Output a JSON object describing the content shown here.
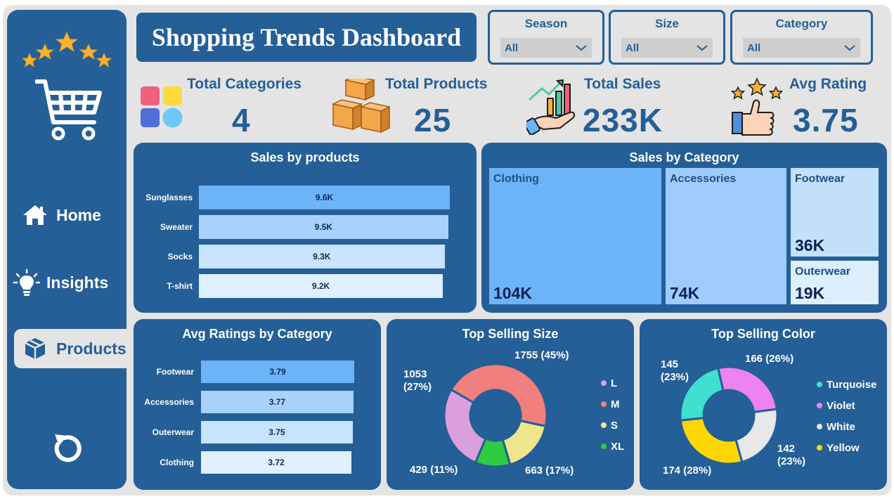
{
  "title": "Shopping Trends Dashboard",
  "nav": [
    {
      "label": "Home",
      "icon": "home-icon"
    },
    {
      "label": "Insights",
      "icon": "lightbulb-icon"
    },
    {
      "label": "Products",
      "icon": "box-icon",
      "active": true
    }
  ],
  "slicers": [
    {
      "label": "Season",
      "value": "All"
    },
    {
      "label": "Size",
      "value": "All"
    },
    {
      "label": "Category",
      "value": "All"
    }
  ],
  "kpis": [
    {
      "title": "Total Categories",
      "value": "4",
      "icon": "categories-icon"
    },
    {
      "title": "Total Products",
      "value": "25",
      "icon": "boxes-icon"
    },
    {
      "title": "Total Sales",
      "value": "233K",
      "icon": "sales-growth-icon"
    },
    {
      "title": "Avg Rating",
      "value": "3.75",
      "icon": "thumbs-up-stars-icon"
    }
  ],
  "colors": {
    "primary": "#245f97",
    "background": "#e4e4e4",
    "bar1": "#6cb4f7",
    "bar2": "#a8d2fb",
    "bar3": "#c8e3fc",
    "bar4": "#e0f0fe"
  },
  "sales_by_products": {
    "title": "Sales by products",
    "chart_data": {
      "type": "bar",
      "categories": [
        "Sunglasses",
        "Sweater",
        "Socks",
        "T-shirt"
      ],
      "values": [
        9.6,
        9.5,
        9.3,
        9.2
      ],
      "labels": [
        "9.6K",
        "9.5K",
        "9.3K",
        "9.2K"
      ]
    }
  },
  "sales_by_category": {
    "title": "Sales by Category",
    "chart_data": {
      "type": "treemap",
      "categories": [
        "Clothing",
        "Accessories",
        "Footwear",
        "Outerwear"
      ],
      "values": [
        104,
        74,
        36,
        19
      ],
      "labels": [
        "104K",
        "74K",
        "36K",
        "19K"
      ]
    }
  },
  "avg_ratings": {
    "title": "Avg Ratings by Category",
    "chart_data": {
      "type": "bar",
      "categories": [
        "Footwear",
        "Accessories",
        "Outerwear",
        "Clothing"
      ],
      "values": [
        3.79,
        3.77,
        3.75,
        3.72
      ],
      "labels": [
        "3.79",
        "3.77",
        "3.75",
        "3.72"
      ]
    }
  },
  "top_size": {
    "title": "Top Selling Size",
    "chart_data": {
      "type": "pie",
      "categories": [
        "L",
        "M",
        "S",
        "XL"
      ],
      "values": [
        1053,
        1755,
        663,
        429
      ],
      "labels": [
        "1053 (27%)",
        "1755 (45%)",
        "663 (17%)",
        "429 (11%)"
      ],
      "colors": [
        "#dc9fdd",
        "#f07f7d",
        "#eee68c",
        "#2ecc40"
      ]
    }
  },
  "top_color": {
    "title": "Top Selling Color",
    "chart_data": {
      "type": "pie",
      "categories": [
        "Turquoise",
        "Violet",
        "White",
        "Yellow"
      ],
      "values": [
        145,
        166,
        142,
        174
      ],
      "labels": [
        "145 (23%)",
        "166 (26%)",
        "142 (23%)",
        "174 (28%)"
      ],
      "colors": [
        "#40e0d0",
        "#ee82ee",
        "#e8e8e8",
        "#ffd700"
      ]
    }
  }
}
